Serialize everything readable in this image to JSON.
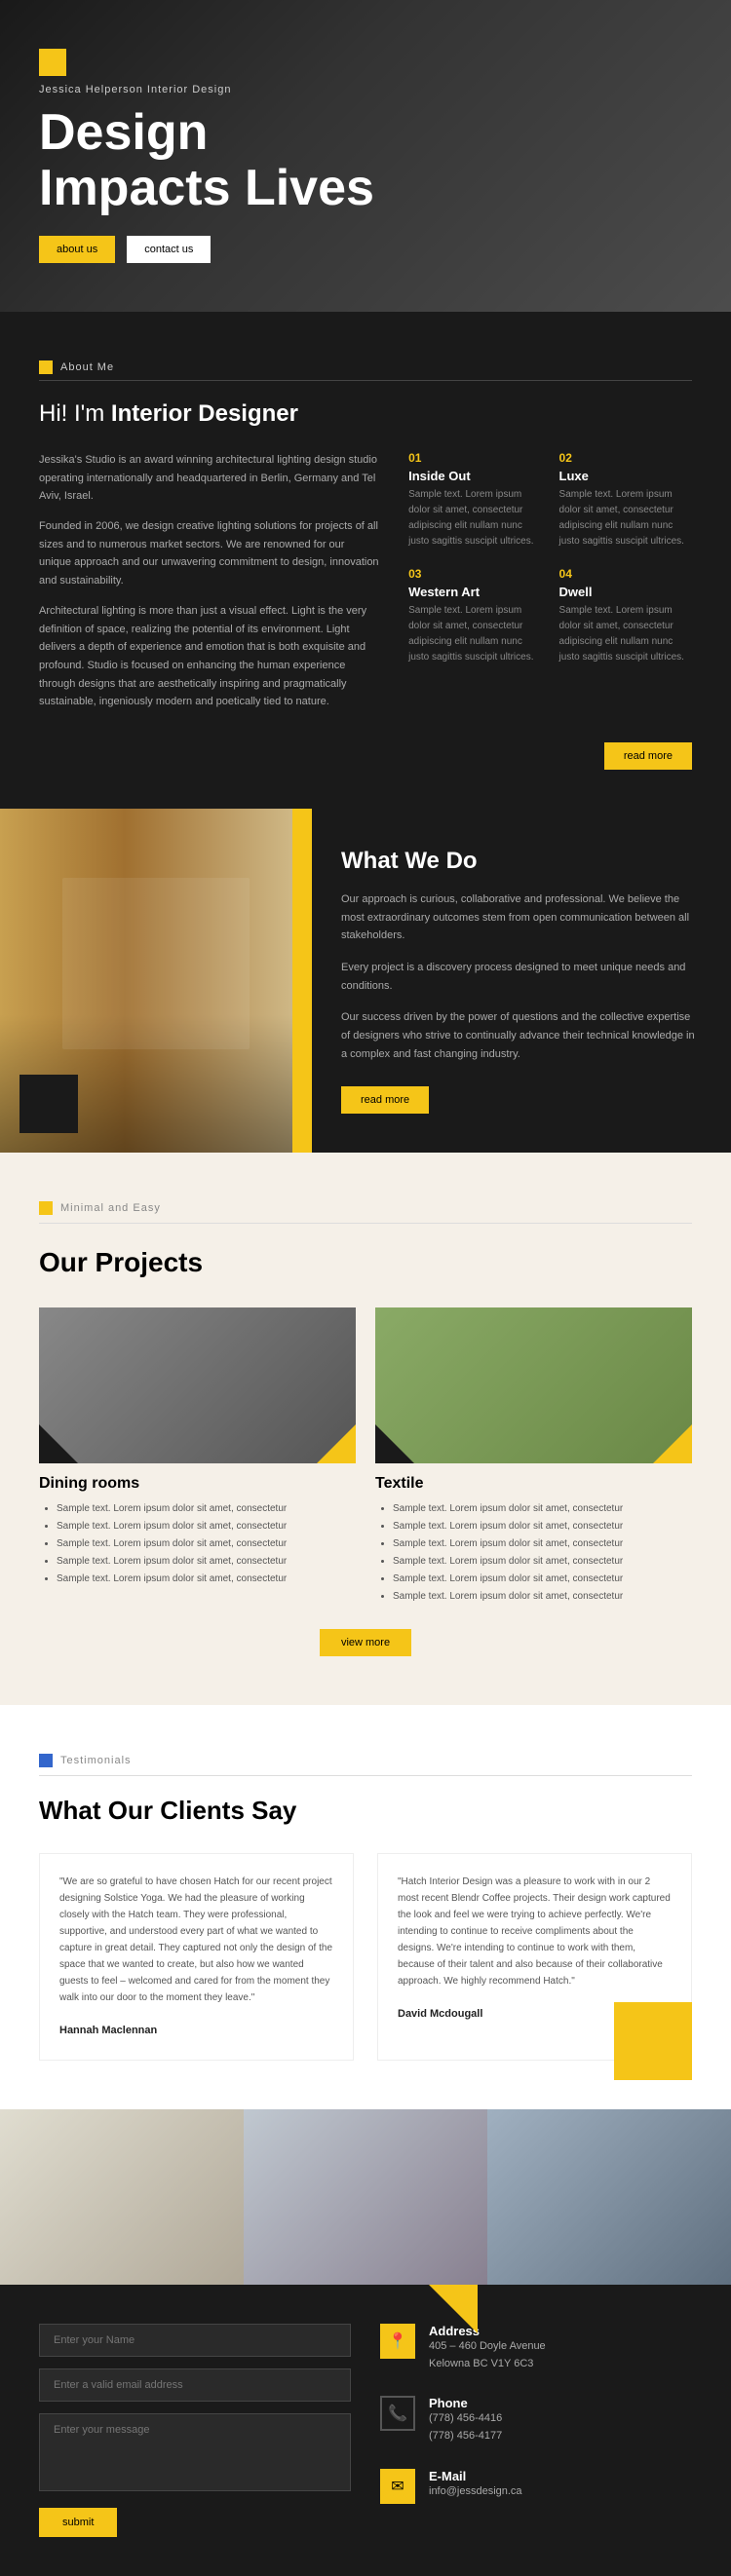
{
  "hero": {
    "brand": "Jessica Helperson  Interior Design",
    "title_line1": "Design",
    "title_line2": "Impacts Lives",
    "btn_about": "about us",
    "btn_contact": "contact us"
  },
  "about": {
    "label": "About Me",
    "heading_plain": "Hi! I'm ",
    "heading_bold": "Interior Designer",
    "paragraph1": "Jessika's Studio is an award winning architectural lighting design studio operating internationally and headquartered in Berlin, Germany and Tel Aviv, Israel.",
    "paragraph2": "Founded in 2006, we design creative lighting solutions for projects of all sizes and to numerous market sectors. We are renowned for our unique approach and our unwavering commitment to design, innovation and sustainability.",
    "paragraph3": "Architectural lighting is more than just a visual effect. Light is the very definition of space, realizing the potential of its environment. Light delivers a depth of experience and emotion that is both exquisite and profound. Studio is focused on enhancing the human experience through designs that are aesthetically inspiring and pragmatically sustainable, ingeniously modern and poetically tied to nature.",
    "read_more": "read more",
    "features": [
      {
        "num": "01",
        "title": "Inside Out",
        "text": "Sample text. Lorem ipsum dolor sit amet, consectetur adipiscing elit nullam nunc justo sagittis suscipit ultrices."
      },
      {
        "num": "02",
        "title": "Luxe",
        "text": "Sample text. Lorem ipsum dolor sit amet, consectetur adipiscing elit nullam nunc justo sagittis suscipit ultrices."
      },
      {
        "num": "03",
        "title": "Western Art",
        "text": "Sample text. Lorem ipsum dolor sit amet, consectetur adipiscing elit nullam nunc justo sagittis suscipit ultrices."
      },
      {
        "num": "04",
        "title": "Dwell",
        "text": "Sample text. Lorem ipsum dolor sit amet, consectetur adipiscing elit nullam nunc justo sagittis suscipit ultrices."
      }
    ]
  },
  "what_we_do": {
    "heading_plain": "What ",
    "heading_bold": "We Do",
    "text1": "Our approach is curious, collaborative and professional. We believe the most extraordinary outcomes stem from open communication between all stakeholders.",
    "text2": "Every project is a discovery process designed to meet unique needs and conditions.",
    "text3": "Our success driven by the power of questions and the collective expertise of designers who strive to continually advance their technical knowledge in a complex and fast changing industry.",
    "read_more": "read more"
  },
  "projects": {
    "label": "Minimal and Easy",
    "heading": "Our Projects",
    "view_more": "view more",
    "items": [
      {
        "title": "Dining rooms",
        "list": [
          "Sample text. Lorem ipsum dolor sit amet, consectetur",
          "Sample text. Lorem ipsum dolor sit amet, consectetur",
          "Sample text. Lorem ipsum dolor sit amet, consectetur",
          "Sample text. Lorem ipsum dolor sit amet, consectetur",
          "Sample text. Lorem ipsum dolor sit amet, consectetur"
        ]
      },
      {
        "title": "Textile",
        "list": [
          "Sample text. Lorem ipsum dolor sit amet, consectetur",
          "Sample text. Lorem ipsum dolor sit amet, consectetur",
          "Sample text. Lorem ipsum dolor sit amet, consectetur",
          "Sample text. Lorem ipsum dolor sit amet, consectetur",
          "Sample text. Lorem ipsum dolor sit amet, consectetur",
          "Sample text. Lorem ipsum dolor sit amet, consectetur"
        ]
      }
    ]
  },
  "testimonials": {
    "label": "Testimonials",
    "heading_plain": "What Our ",
    "heading_bold": "Clients Say",
    "items": [
      {
        "text": "\"We are so grateful to have chosen Hatch for our recent project designing Solstice Yoga. We had the pleasure of working closely with the Hatch team. They were professional, supportive, and understood every part of what we wanted to capture in great detail. They captured not only the design of the space that we wanted to create, but also how we wanted guests to feel – welcomed and cared for from the moment they walk into our door to the moment they leave.\"",
        "author": "Hannah Maclennan"
      },
      {
        "text": "\"Hatch Interior Design was a pleasure to work with in our 2 most recent Blendr Coffee projects. Their design work captured the look and feel we were trying to achieve perfectly. We're intending to continue to receive compliments about the designs. We're intending to continue to work with them, because of their talent and also because of their collaborative approach. We highly recommend Hatch.\"",
        "author": "David Mcdougall"
      }
    ]
  },
  "contact": {
    "form": {
      "name_placeholder": "Enter your Name",
      "email_placeholder": "Enter a valid email address",
      "message_placeholder": "Enter your message",
      "submit_label": "submit"
    },
    "info": [
      {
        "icon": "📍",
        "label": "Address",
        "value": "405 – 460 Doyle Avenue\nKelowna BC V1Y 6C3"
      },
      {
        "icon": "📞",
        "label": "Phone",
        "value": "(778) 456-4416\n(778) 456-4177"
      },
      {
        "icon": "✉",
        "label": "E-Mail",
        "value": "info@jessdesign.ca"
      }
    ]
  }
}
